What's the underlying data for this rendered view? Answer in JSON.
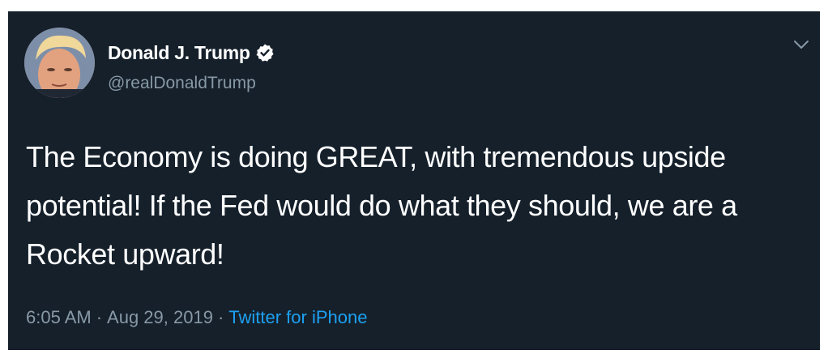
{
  "tweet": {
    "author": {
      "display_name": "Donald J. Trump",
      "handle": "@realDonaldTrump",
      "verified": true,
      "avatar_icon": "profile-photo"
    },
    "text": "The Economy is doing GREAT, with tremendous upside potential! If the Fed would do what they should, we are a Rocket upward!",
    "time": "6:05 AM",
    "separator": "·",
    "date": "Aug 29, 2019",
    "source": "Twitter for iPhone",
    "menu_icon": "chevron-down-icon"
  },
  "theme": {
    "background": "#15202b",
    "text": "#ffffff",
    "secondary_text": "#8899a6",
    "link": "#1da1f2",
    "verified_badge": "#ffffff"
  }
}
